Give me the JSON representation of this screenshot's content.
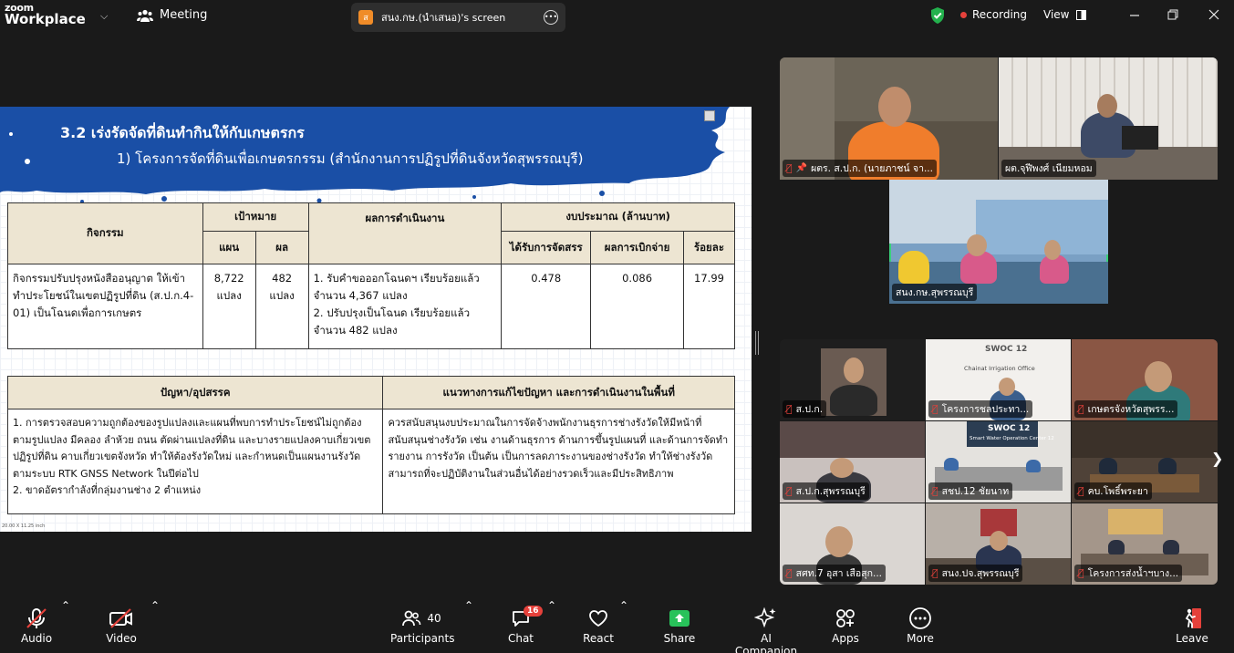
{
  "app": {
    "brand_top": "zoom",
    "brand_bottom": "Workplace"
  },
  "header": {
    "meeting_label": "Meeting",
    "share_icon_letter": "ส",
    "share_title": "สนง.กษ.(นำเสนอ)'s screen",
    "recording_label": "Recording",
    "view_label": "View"
  },
  "slide": {
    "title": "3.2 เร่งรัดจัดที่ดินทำกินให้กับเกษตรกร",
    "subtitle": "1) โครงการจัดที่ดินเพื่อเกษตรกรรม (สำนักงานการปฏิรูปที่ดินจังหวัดสุพรรณบุรี)",
    "table1": {
      "h_activity": "กิจกรรม",
      "h_target": "เป้าหมาย",
      "h_plan": "แผน",
      "h_result": "ผล",
      "h_performance": "ผลการดำเนินงาน",
      "h_budget": "งบประมาณ (ล้านบาท)",
      "h_allocated": "ได้รับการจัดสรร",
      "h_disbursed": "ผลการเบิกจ่าย",
      "h_percent": "ร้อยละ",
      "activity": "กิจกรรมปรับปรุงหนังสืออนุญาต ให้เข้าทำประโยชน์ในเขตปฏิรูปที่ดิน (ส.ป.ก.4-01) เป็นโฉนดเพื่อการเกษตร",
      "plan": "8,722 แปลง",
      "result": "482 แปลง",
      "performance_1": "1. รับคำขอออกโฉนดฯ เรียบร้อยแล้ว จำนวน 4,367 แปลง",
      "performance_2": "2. ปรับปรุงเป็นโฉนด เรียบร้อยแล้ว จำนวน 482 แปลง",
      "allocated": "0.478",
      "disbursed": "0.086",
      "percent": "17.99"
    },
    "table2": {
      "h_problems": "ปัญหา/อุปสรรค",
      "h_solutions": "แนวทางการแก้ไขปัญหา และการดำเนินงานในพื้นที่",
      "problem_1": "1. การตรวจสอบความถูกต้องของรูปแปลงและแผนที่พบการทำประโยชน์ไม่ถูกต้องตามรูปแปลง มีคลอง ลำห้วย ถนน ตัดผ่านแปลงที่ดิน และบางรายแปลงคาบเกี่ยวเขตปฏิรูปที่ดิน คาบเกี่ยวเขตจังหวัด ทำให้ต้องรังวัดใหม่ และกำหนดเป็นแผนงานรังวัดตามระบบ RTK GNSS Network ในปีต่อไป",
      "problem_2": "2. ขาดอัตรากำลังที่กลุ่มงานช่าง 2 ตำแหน่ง",
      "solution": "ควรสนับสนุนงบประมาณในการจัดจ้างพนักงานธุรการช่างรังวัดให้มีหน้าที่สนับสนุนช่างรังวัด เช่น งานด้านธุรการ ด้านการขึ้นรูปแผนที่ และด้านการจัดทำรายงาน การรังวัด เป็นต้น เป็นการลดภาระงานของช่างรังวัด ทำให้ช่างรังวัดสามารถที่จะปฏิบัติงานในส่วนอื่นได้อย่างรวดเร็วและมีประสิทธิภาพ"
    },
    "footer": "20.00 X 11.25 inch"
  },
  "participants_top": [
    {
      "name": "ผตร. ส.ป.ก. (นายภาชน์  จา...",
      "pinned": true
    },
    {
      "name": "ผต.จุฬีพงศ์  เนียมหอม"
    },
    {
      "name": "สนง.กษ.สุพรรณบุรี"
    }
  ],
  "participants_grid": [
    {
      "name": "ส.ป.ก."
    },
    {
      "name": "โครงการชลประทา...",
      "wall_text_1": "SWOC 12",
      "wall_text_2": "Chainat Irrigation Office"
    },
    {
      "name": "เกษตรจังหวัดสุพรร..."
    },
    {
      "name": "ส.ป.ก.สุพรรณบุรี"
    },
    {
      "name": "สชป.12 ชัยนาท",
      "wall_text_1": "SWOC 12",
      "wall_text_2": "Smart Water Operation Center 12"
    },
    {
      "name": "คบ.โพธิ์พระยา"
    },
    {
      "name": "สศท.7 อุสา เสือสุก..."
    },
    {
      "name": "สนง.ปจ.สุพรรณบุรี"
    },
    {
      "name": "โครงการส่งน้ำฯบาง..."
    }
  ],
  "toolbar": {
    "audio": "Audio",
    "video": "Video",
    "participants": "Participants",
    "participants_count": "40",
    "chat": "Chat",
    "chat_badge": "16",
    "react": "React",
    "share": "Share",
    "ai_companion": "AI Companion",
    "apps": "Apps",
    "more": "More",
    "leave": "Leave"
  },
  "colors": {
    "accent_green": "#3ad17a",
    "record_red": "#e5413b",
    "share_green": "#28c25a",
    "slide_blue": "#1a4fa6"
  }
}
